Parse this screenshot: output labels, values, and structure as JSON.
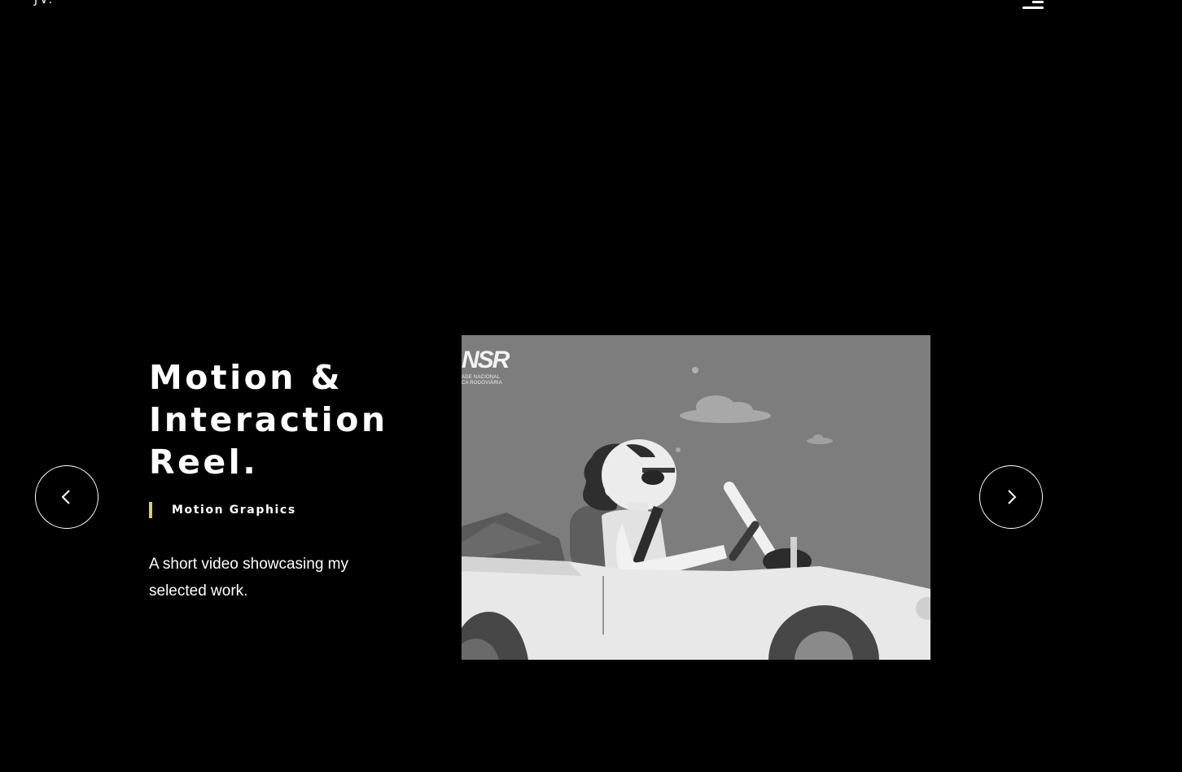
{
  "header": {
    "logo_text": "JV.",
    "menu_icon": "hamburger-menu-icon"
  },
  "project": {
    "title_lines": [
      "Motion &",
      "Interaction",
      "Reel."
    ],
    "category": "Motion Graphics",
    "category_accent": "#d4d45a",
    "description": "A short video showcasing my selected work."
  },
  "media": {
    "logo_mark": "NSR",
    "logo_line_1": "ADE NACIONAL",
    "logo_line_2": "CA RODOVIÁRIA"
  },
  "navigation": {
    "prev_icon": "chevron-left-icon",
    "next_icon": "chevron-right-icon"
  },
  "colors": {
    "background": "#000000",
    "text": "#ffffff",
    "accent": "#d4d45a"
  }
}
